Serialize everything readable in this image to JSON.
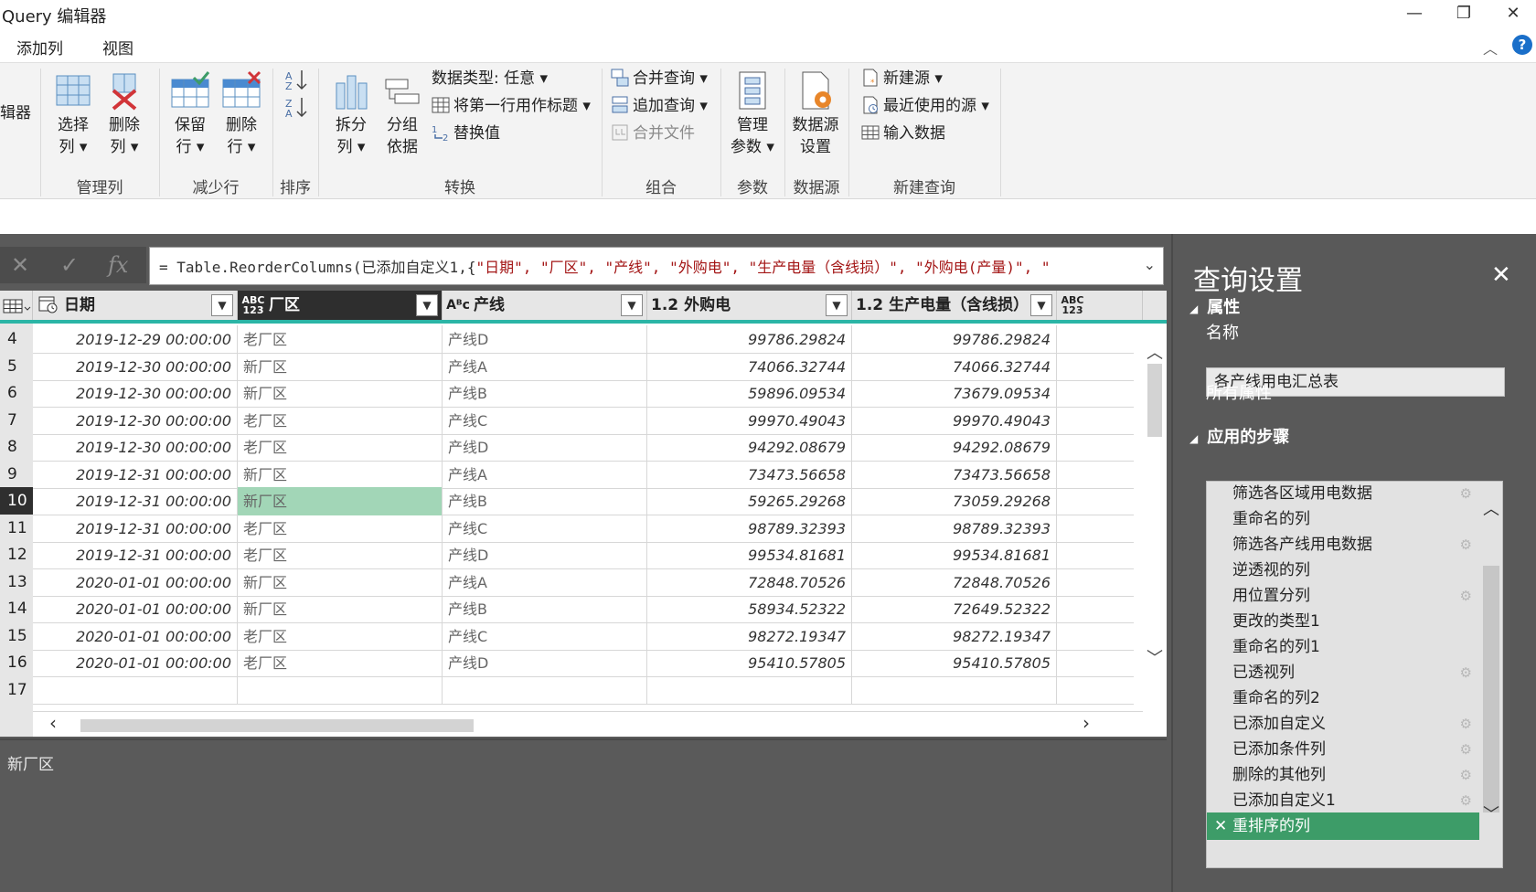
{
  "window": {
    "title": "Query 编辑器",
    "minimize": "—",
    "restore": "❐",
    "close": "✕"
  },
  "menu": {
    "tabs": [
      "添加列",
      "视图"
    ],
    "collapse": "︿",
    "help": "?"
  },
  "ribbon": {
    "cut_label": "辑器",
    "manage_cols": {
      "label": "管理列",
      "choose": [
        "选择",
        "列 ▾"
      ],
      "remove": [
        "删除",
        "列 ▾"
      ]
    },
    "reduce_rows": {
      "label": "减少行",
      "keep": [
        "保留",
        "行 ▾"
      ],
      "remove": [
        "删除",
        "行 ▾"
      ]
    },
    "sort": {
      "label": "排序"
    },
    "transform": {
      "label": "转换",
      "split": [
        "拆分",
        "列 ▾"
      ],
      "group": [
        "分组",
        "依据"
      ],
      "data_type": "数据类型: 任意 ▾",
      "first_row_header": "将第一行用作标题 ▾",
      "replace": "替换值"
    },
    "combine": {
      "label": "组合",
      "merge": "合并查询 ▾",
      "append": "追加查询 ▾",
      "merge_files": "合并文件"
    },
    "params": {
      "label": "参数",
      "manage": [
        "管理",
        "参数 ▾"
      ]
    },
    "datasource": {
      "label": "数据源",
      "settings": [
        "数据源",
        "设置"
      ]
    },
    "new_query": {
      "label": "新建查询",
      "new_source": "新建源 ▾",
      "recent": "最近使用的源 ▾",
      "enter_data": "输入数据"
    }
  },
  "formula": {
    "cancel": "✕",
    "commit": "✓",
    "fx": "fx",
    "prefix": "= Table.ReorderColumns(已添加自定义1,{",
    "strings": "\"日期\", \"厂区\", \"产线\", \"外购电\", \"生产电量（含线损）\", \"外购电(产量)\", \"",
    "expand": "⌄"
  },
  "grid": {
    "columns": [
      {
        "type": "▦",
        "name": "日期"
      },
      {
        "type": "ABC\n123",
        "name": "厂区"
      },
      {
        "type": "Aᴮc",
        "name": "产线"
      },
      {
        "type": "1.2",
        "name": "外购电"
      },
      {
        "type": "1.2",
        "name": "生产电量（含线损）"
      },
      {
        "type": "ABC\n123",
        "name": ""
      }
    ],
    "rows": [
      {
        "n": "4",
        "date": "2019-12-29 00:00:00",
        "area": "老厂区",
        "line": "产线D",
        "buy": "99786.29824",
        "prod": "99786.29824"
      },
      {
        "n": "5",
        "date": "2019-12-30 00:00:00",
        "area": "新厂区",
        "line": "产线A",
        "buy": "74066.32744",
        "prod": "74066.32744"
      },
      {
        "n": "6",
        "date": "2019-12-30 00:00:00",
        "area": "新厂区",
        "line": "产线B",
        "buy": "59896.09534",
        "prod": "73679.09534"
      },
      {
        "n": "7",
        "date": "2019-12-30 00:00:00",
        "area": "老厂区",
        "line": "产线C",
        "buy": "99970.49043",
        "prod": "99970.49043"
      },
      {
        "n": "8",
        "date": "2019-12-30 00:00:00",
        "area": "老厂区",
        "line": "产线D",
        "buy": "94292.08679",
        "prod": "94292.08679"
      },
      {
        "n": "9",
        "date": "2019-12-31 00:00:00",
        "area": "新厂区",
        "line": "产线A",
        "buy": "73473.56658",
        "prod": "73473.56658"
      },
      {
        "n": "10",
        "date": "2019-12-31 00:00:00",
        "area": "新厂区",
        "line": "产线B",
        "buy": "59265.29268",
        "prod": "73059.29268"
      },
      {
        "n": "11",
        "date": "2019-12-31 00:00:00",
        "area": "老厂区",
        "line": "产线C",
        "buy": "98789.32393",
        "prod": "98789.32393"
      },
      {
        "n": "12",
        "date": "2019-12-31 00:00:00",
        "area": "老厂区",
        "line": "产线D",
        "buy": "99534.81681",
        "prod": "99534.81681"
      },
      {
        "n": "13",
        "date": "2020-01-01 00:00:00",
        "area": "新厂区",
        "line": "产线A",
        "buy": "72848.70526",
        "prod": "72848.70526"
      },
      {
        "n": "14",
        "date": "2020-01-01 00:00:00",
        "area": "新厂区",
        "line": "产线B",
        "buy": "58934.52322",
        "prod": "72649.52322"
      },
      {
        "n": "15",
        "date": "2020-01-01 00:00:00",
        "area": "老厂区",
        "line": "产线C",
        "buy": "98272.19347",
        "prod": "98272.19347"
      },
      {
        "n": "16",
        "date": "2020-01-01 00:00:00",
        "area": "老厂区",
        "line": "产线D",
        "buy": "95410.57805",
        "prod": "95410.57805"
      },
      {
        "n": "17",
        "date": "",
        "area": "",
        "line": "",
        "buy": "",
        "prod": ""
      }
    ],
    "selected_row": "10",
    "status_value": "新厂区"
  },
  "settings": {
    "title": "查询设置",
    "close": "✕",
    "properties": "属性",
    "name_label": "名称",
    "name_value": "各产线用电汇总表",
    "all_props": "所有属性",
    "steps_label": "应用的步骤",
    "steps": [
      {
        "label": "筛选各区域用电数据",
        "gear": true
      },
      {
        "label": "重命名的列",
        "gear": false
      },
      {
        "label": "筛选各产线用电数据",
        "gear": true
      },
      {
        "label": "逆透视的列",
        "gear": false
      },
      {
        "label": "用位置分列",
        "gear": true
      },
      {
        "label": "更改的类型1",
        "gear": false
      },
      {
        "label": "重命名的列1",
        "gear": false
      },
      {
        "label": "已透视列",
        "gear": true
      },
      {
        "label": "重命名的列2",
        "gear": false
      },
      {
        "label": "已添加自定义",
        "gear": true
      },
      {
        "label": "已添加条件列",
        "gear": true
      },
      {
        "label": "删除的其他列",
        "gear": true
      },
      {
        "label": "已添加自定义1",
        "gear": true
      },
      {
        "label": "重排序的列",
        "gear": false
      }
    ],
    "active_step": "重排序的列"
  },
  "colors": {
    "accent_teal": "#2bb5a6",
    "selected_cell": "#a2d6b7",
    "active_step": "#3d9c68",
    "string_red": "#a31515"
  }
}
